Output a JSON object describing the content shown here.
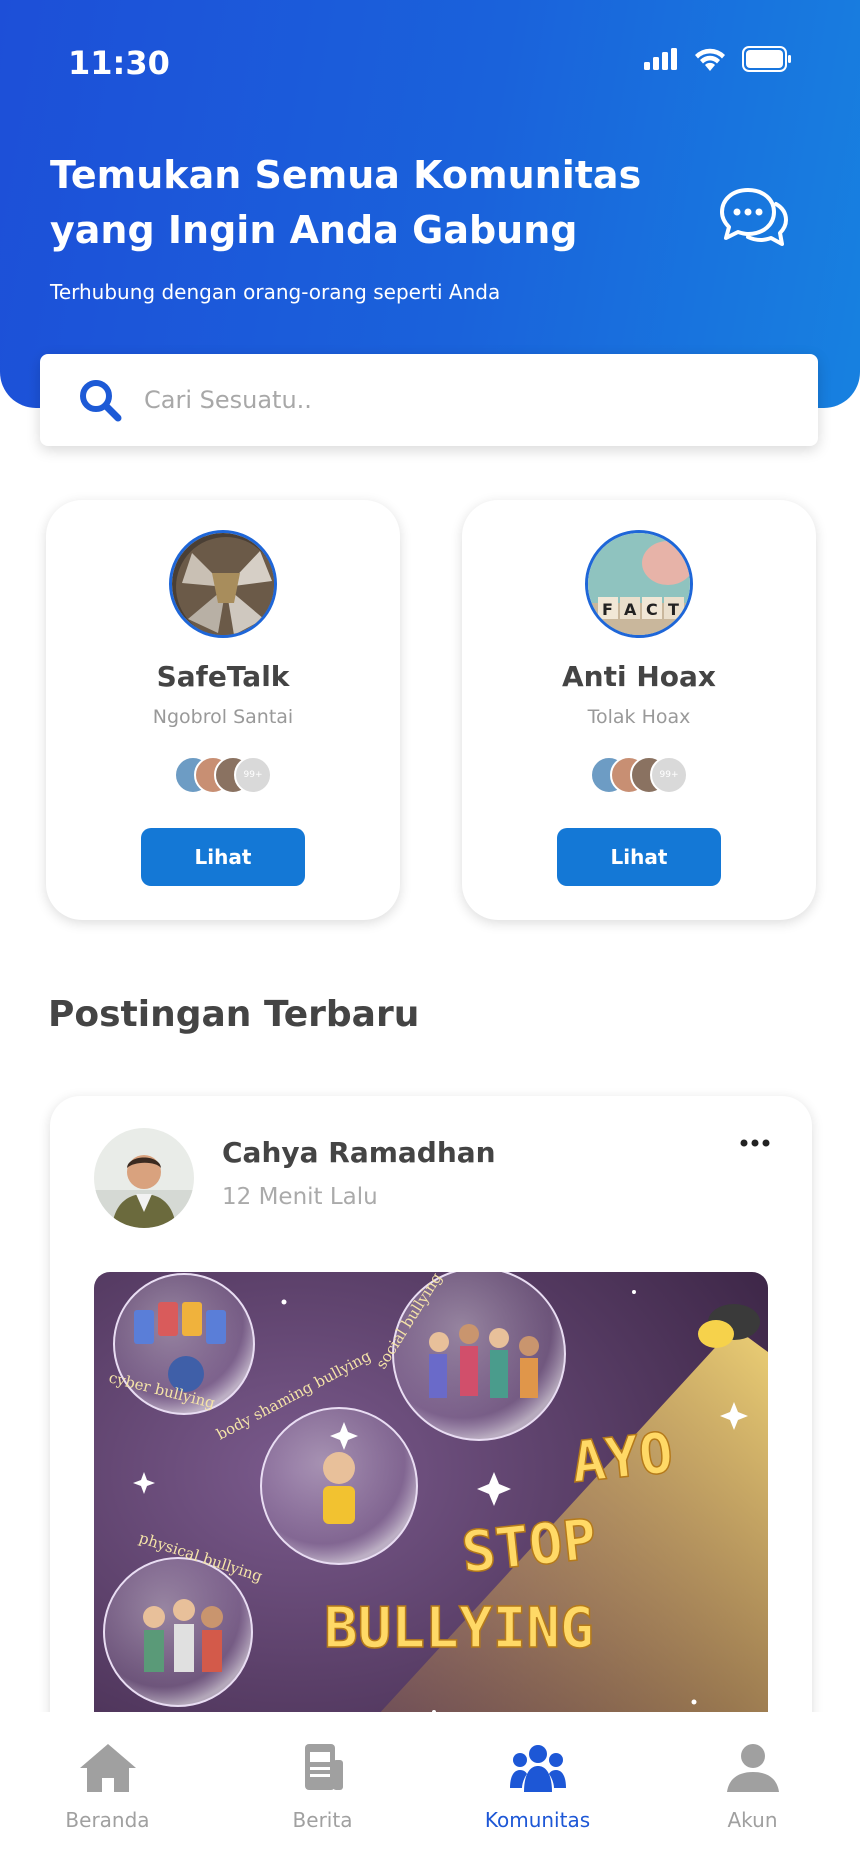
{
  "status_bar": {
    "time": "11:30"
  },
  "header": {
    "title": "Temukan Semua Komunitas yang Ingin Anda Gabung",
    "subtitle": "Terhubung dengan orang-orang seperti Anda"
  },
  "search": {
    "placeholder": "Cari Sesuatu.."
  },
  "communities": [
    {
      "name": "SafeTalk",
      "tagline": "Ngobrol Santai",
      "members_more": "99+",
      "button": "Lihat"
    },
    {
      "name": "Anti Hoax",
      "tagline": "Tolak Hoax",
      "members_more": "99+",
      "button": "Lihat"
    }
  ],
  "section": {
    "title": "Postingan Terbaru"
  },
  "post": {
    "author": "Cahya Ramadhan",
    "time": "12 Menit Lalu",
    "image_text": {
      "cyber": "cyber bullying",
      "body": "body shaming bullying",
      "social": "social bullying",
      "physical": "physical bullying",
      "line1": "AYO",
      "line2": "STOP",
      "line3": "BULLYING"
    }
  },
  "nav": {
    "items": [
      {
        "label": "Beranda",
        "icon": "home-icon"
      },
      {
        "label": "Berita",
        "icon": "news-icon"
      },
      {
        "label": "Komunitas",
        "icon": "community-icon"
      },
      {
        "label": "Akun",
        "icon": "account-icon"
      }
    ],
    "active": "Komunitas"
  },
  "colors": {
    "primary": "#1d4fd8",
    "button": "#1478d6",
    "active_nav": "#1d57d6",
    "inactive_nav": "#a0a0a0"
  }
}
